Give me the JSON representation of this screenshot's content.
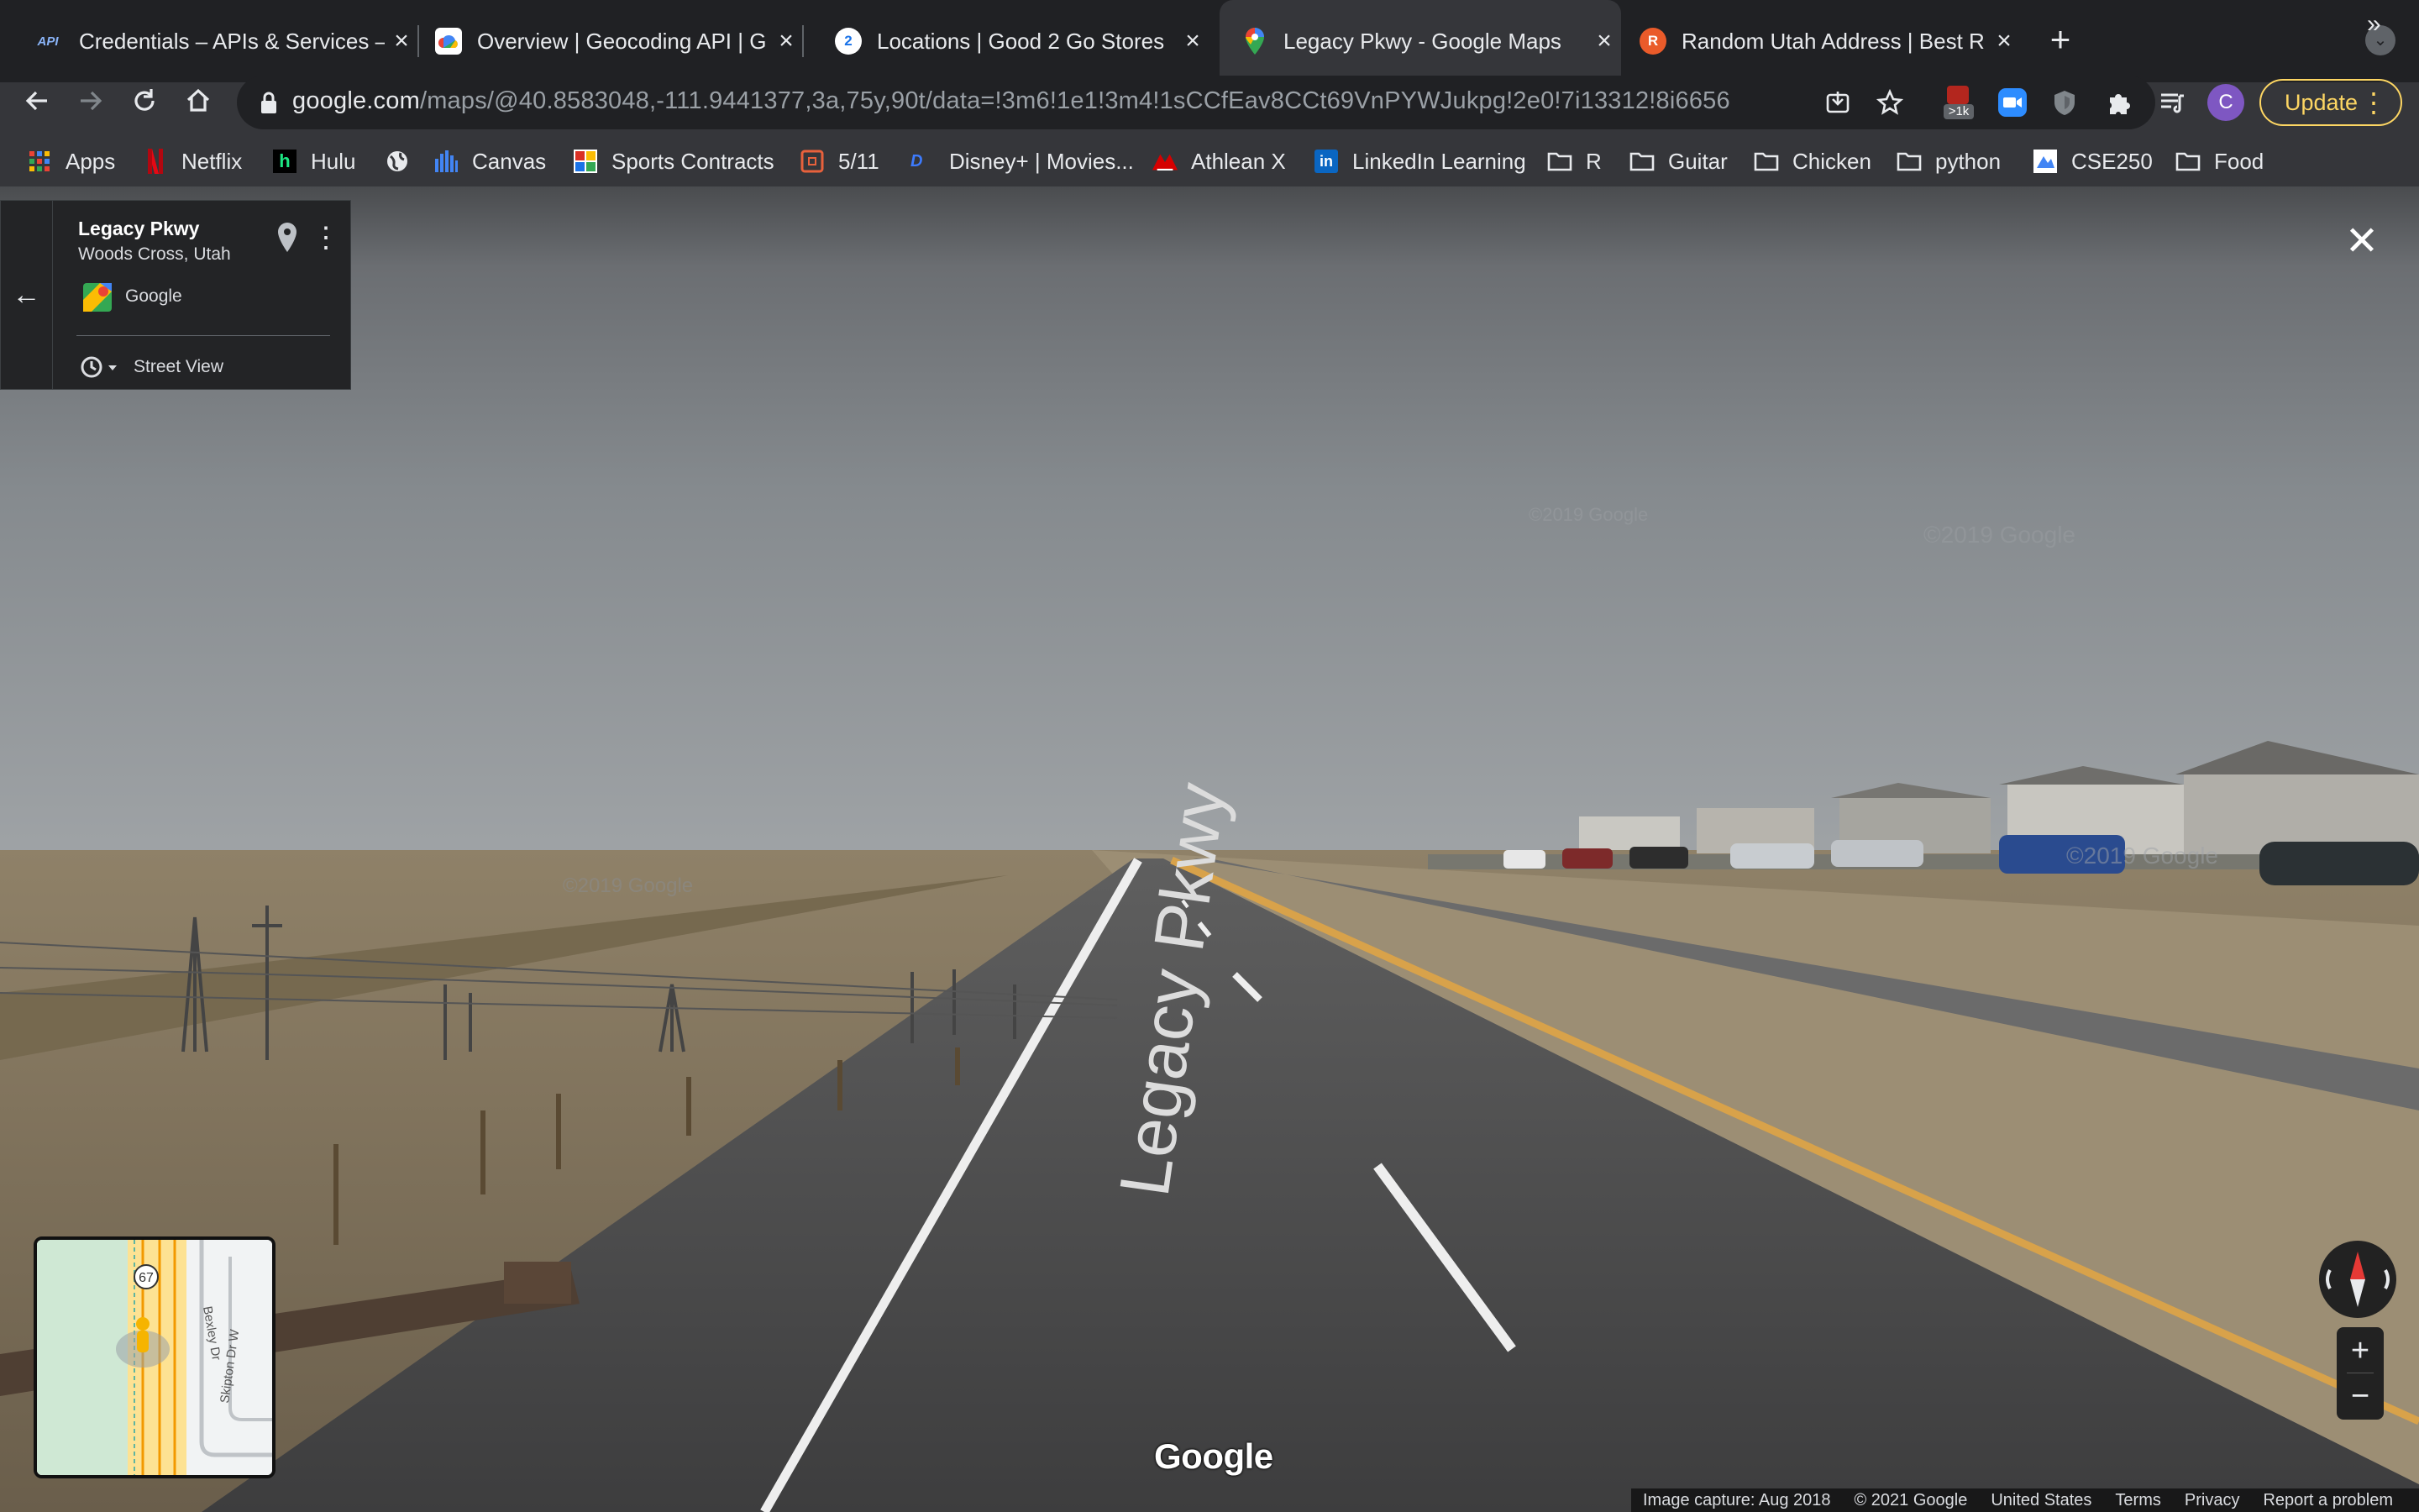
{
  "tabs": [
    {
      "title": "Credentials – APIs & Services –",
      "favicon": "API",
      "icon": "api-icon",
      "active": false
    },
    {
      "title": "Overview  |  Geocoding API  |  G",
      "favicon": "",
      "icon": "google-cloud-icon",
      "active": false
    },
    {
      "title": "Locations | Good 2 Go Stores",
      "favicon": "2",
      "icon": "good2go-icon",
      "active": false
    },
    {
      "title": "Legacy Pkwy - Google Maps",
      "favicon": "",
      "icon": "google-maps-icon",
      "active": true
    },
    {
      "title": "Random Utah Address | Best R",
      "favicon": "R",
      "icon": "random-address-icon",
      "active": false
    }
  ],
  "address_bar": {
    "host": "google.com",
    "path": "/maps/@40.8583048,-111.9441377,3a,75y,90t/data=!3m6!1e1!3m4!1sCCfEav8CCt69VnPYWJukpg!2e0!7i13312!8i6656"
  },
  "toolbar": {
    "extension_badge": ">1k",
    "profile_initial": "C",
    "update_label": "Update"
  },
  "bookmarks": [
    {
      "label": "Apps",
      "icon": "apps-grid-icon"
    },
    {
      "label": "Netflix",
      "icon": "netflix-icon"
    },
    {
      "label": "Hulu",
      "icon": "hulu-icon"
    },
    {
      "label": "",
      "icon": "globe-icon"
    },
    {
      "label": "Canvas",
      "icon": "canvas-icon"
    },
    {
      "label": "Sports Contracts",
      "icon": "sports-icon"
    },
    {
      "label": "5/11",
      "icon": "calendar-icon"
    },
    {
      "label": "Disney+ | Movies...",
      "icon": "disney-icon"
    },
    {
      "label": "Athlean X",
      "icon": "athlean-icon"
    },
    {
      "label": "LinkedIn Learning",
      "icon": "linkedin-icon"
    },
    {
      "label": "R",
      "icon": "folder-icon"
    },
    {
      "label": "Guitar",
      "icon": "folder-icon"
    },
    {
      "label": "Chicken",
      "icon": "folder-icon"
    },
    {
      "label": "python",
      "icon": "folder-icon"
    },
    {
      "label": "CSE250",
      "icon": "cse-icon"
    },
    {
      "label": "Food",
      "icon": "folder-icon"
    }
  ],
  "info_card": {
    "place": "Legacy Pkwy",
    "locality": "Woods Cross, Utah",
    "source": "Google",
    "mode": "Street View"
  },
  "scene": {
    "road_label": "Legacy Pkwy",
    "watermark": "©2019 Google"
  },
  "minimap": {
    "route_shield": "67",
    "street_1": "Bexley Dr",
    "street_2": "Skipton Dr W"
  },
  "watermark": "Google",
  "footer": {
    "capture": "Image capture: Aug 2018",
    "copyright": "© 2021 Google",
    "country": "United States",
    "terms": "Terms",
    "privacy": "Privacy",
    "report": "Report a problem"
  },
  "colors": {
    "chrome_dark": "#202124",
    "chrome_toolbar": "#35363a",
    "update_accent": "#fdd663",
    "profile": "#7e57c2"
  }
}
